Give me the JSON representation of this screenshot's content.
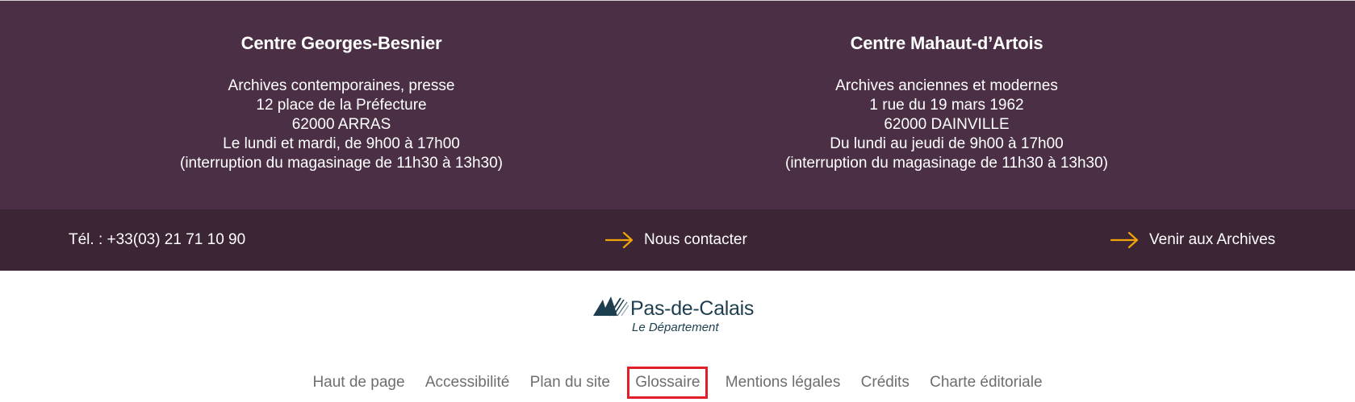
{
  "centers": [
    {
      "title": "Centre Georges-Besnier",
      "lines": [
        "Archives contemporaines, presse",
        "12 place de la Préfecture",
        "62000 ARRAS",
        "Le lundi et mardi, de 9h00 à 17h00",
        "(interruption du magasinage de 11h30 à 13h30)"
      ]
    },
    {
      "title": "Centre Mahaut-d’Artois",
      "lines": [
        "Archives anciennes et modernes",
        "1 rue du 19 mars 1962",
        "62000 DAINVILLE",
        "Du lundi au jeudi de 9h00 à 17h00",
        "(interruption du magasinage de 11h30 à 13h30)"
      ]
    }
  ],
  "bar": {
    "phone": "Tél. : +33(03) 21 71 10 90",
    "contact_label": "Nous contacter",
    "visit_label": "Venir aux Archives",
    "arrow_color": "#f0a30a"
  },
  "logo": {
    "name": "Pas-de-Calais",
    "subtitle": "Le Département",
    "icon": "mountain-stripes-icon"
  },
  "footer_nav": [
    "Haut de page",
    "Accessibilité",
    "Plan du site",
    "Glossaire",
    "Mentions légales",
    "Crédits",
    "Charte éditoriale"
  ],
  "highlight_color": "#e01f26",
  "colors": {
    "top_bg": "#4a2f45",
    "bar_bg": "#3c2535",
    "logo_color": "#1d3e4e"
  }
}
